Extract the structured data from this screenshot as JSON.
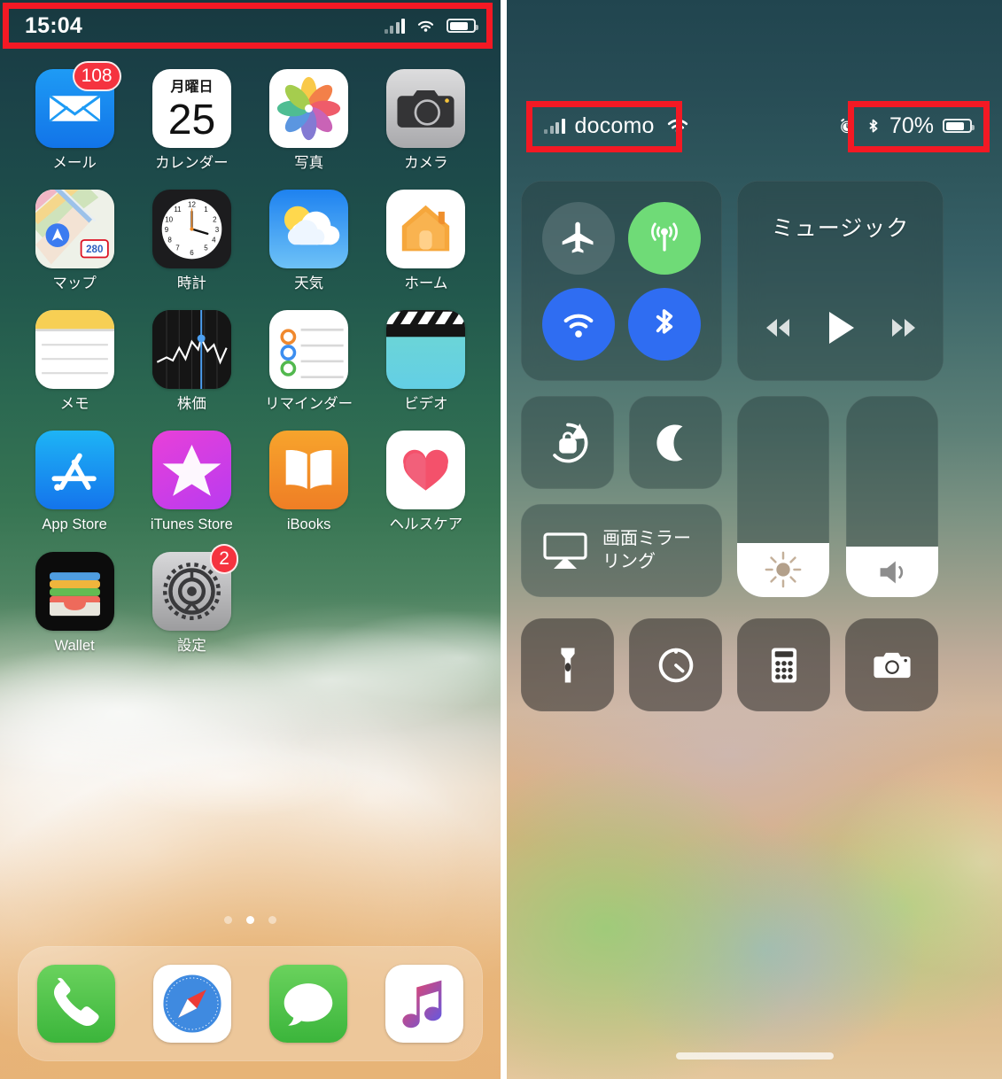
{
  "home_screen": {
    "status_bar": {
      "time": "15:04",
      "signal_icon": "signal-bars-icon",
      "wifi_icon": "wifi-icon",
      "battery_icon": "battery-icon",
      "battery_level_pct": 72,
      "highlight_color": "#f31924"
    },
    "apps": [
      {
        "label": "メール",
        "icon": "mail-icon",
        "badge": "108"
      },
      {
        "label": "カレンダー",
        "icon": "calendar-icon",
        "weekday": "月曜日",
        "day": "25"
      },
      {
        "label": "写真",
        "icon": "photos-icon"
      },
      {
        "label": "カメラ",
        "icon": "camera-icon"
      },
      {
        "label": "マップ",
        "icon": "maps-icon",
        "route_shield": "280"
      },
      {
        "label": "時計",
        "icon": "clock-icon"
      },
      {
        "label": "天気",
        "icon": "weather-icon"
      },
      {
        "label": "ホーム",
        "icon": "home-icon"
      },
      {
        "label": "メモ",
        "icon": "notes-icon"
      },
      {
        "label": "株価",
        "icon": "stocks-icon"
      },
      {
        "label": "リマインダー",
        "icon": "reminders-icon"
      },
      {
        "label": "ビデオ",
        "icon": "videos-icon"
      },
      {
        "label": "App Store",
        "icon": "appstore-icon"
      },
      {
        "label": "iTunes Store",
        "icon": "itunes-store-icon"
      },
      {
        "label": "iBooks",
        "icon": "ibooks-icon"
      },
      {
        "label": "ヘルスケア",
        "icon": "health-icon"
      },
      {
        "label": "Wallet",
        "icon": "wallet-icon"
      },
      {
        "label": "設定",
        "icon": "settings-gear-icon",
        "badge": "2"
      }
    ],
    "page_dots": {
      "count": 3,
      "active_index": 1
    },
    "dock": [
      {
        "label": "Phone",
        "icon": "phone-icon"
      },
      {
        "label": "Safari",
        "icon": "safari-compass-icon"
      },
      {
        "label": "Messages",
        "icon": "messages-bubble-icon"
      },
      {
        "label": "Music",
        "icon": "music-note-icon"
      }
    ]
  },
  "control_center": {
    "status_bar": {
      "carrier": "docomo",
      "signal_icon": "signal-bars-icon",
      "wifi_icon": "wifi-icon",
      "alarm_icon": "alarm-clock-icon",
      "bluetooth_icon": "bluetooth-icon",
      "battery_text": "70%",
      "battery_level_pct": 70,
      "highlight_color": "#f31924"
    },
    "connectivity": {
      "airplane": {
        "name": "airplane-mode-toggle",
        "state": "off",
        "color": "rgba(255,255,255,0.14)"
      },
      "cellular": {
        "name": "cellular-data-toggle",
        "state": "on",
        "color": "#6fdb77"
      },
      "wifi": {
        "name": "wifi-toggle",
        "state": "on",
        "color": "#2f6df2"
      },
      "bluetooth": {
        "name": "bluetooth-toggle",
        "state": "on",
        "color": "#2f6df2"
      }
    },
    "music": {
      "title": "ミュージック",
      "rewind_icon": "rewind-icon",
      "play_icon": "play-icon",
      "forward_icon": "fast-forward-icon"
    },
    "rotation_lock": {
      "icon": "rotation-lock-icon",
      "state": "off"
    },
    "do_not_disturb": {
      "icon": "moon-icon",
      "state": "off"
    },
    "screen_mirroring": {
      "label_line1": "画面ミラー",
      "label_line2": "リング",
      "icon": "airplay-icon"
    },
    "brightness_slider": {
      "icon": "brightness-sun-icon",
      "value_pct": 27
    },
    "volume_slider": {
      "icon": "speaker-volume-icon",
      "value_pct": 25
    },
    "shortcuts": [
      {
        "icon": "flashlight-icon",
        "label": "Flashlight"
      },
      {
        "icon": "timer-icon",
        "label": "Timer"
      },
      {
        "icon": "calculator-icon",
        "label": "Calculator"
      },
      {
        "icon": "camera-icon",
        "label": "Camera"
      }
    ],
    "home_indicator": "home-indicator-bar"
  }
}
